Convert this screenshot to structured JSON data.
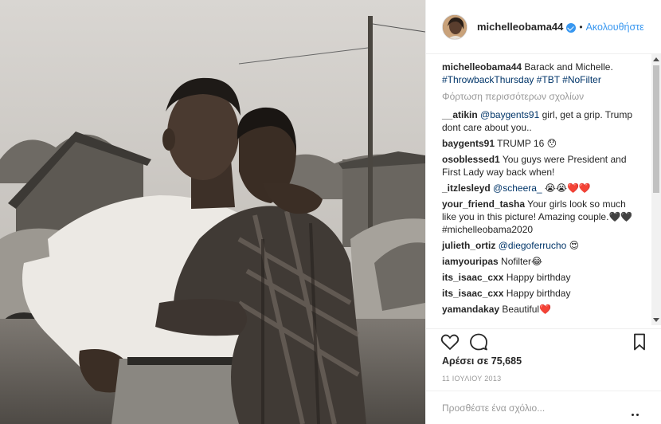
{
  "post": {
    "username": "michelleobama44",
    "separator": "•",
    "follow_label": "Ακολουθήστε",
    "caption_text": "Barack and Michelle.",
    "caption_tags": "#ThrowbackThursday #TBT #NoFilter",
    "load_more": "Φόρτωση περισσότερων σχολίων",
    "likes": "Αρέσει σε 75,685",
    "date": "11 ΙΟΥΛΙΟΥ 2013",
    "comment_placeholder": "Προσθέστε ένα σχόλιο..."
  },
  "comments": [
    {
      "user": "__atikin",
      "mention": "@baygents91",
      "text": " girl, get a grip. Trump dont care about you.."
    },
    {
      "user": "baygents91",
      "mention": "",
      "text": "TRUMP 16 😯"
    },
    {
      "user": "osoblessed1",
      "mention": "",
      "text": "You guys were President and First Lady way back when!"
    },
    {
      "user": "_itzlesleyd",
      "mention": "@scheera_",
      "text": " 😭😭❤️❤️"
    },
    {
      "user": "your_friend_tasha",
      "mention": "",
      "text": "Your girls look so much like you in this picture! Amazing couple.🖤🖤 #michelleobama2020"
    },
    {
      "user": "julieth_ortiz",
      "mention": "@diegoferrucho",
      "text": " 😍"
    },
    {
      "user": "iamyouripas",
      "mention": "",
      "text": "Nofilter😂"
    },
    {
      "user": "its_isaac_cxx",
      "mention": "",
      "text": "Happy birthday"
    },
    {
      "user": "its_isaac_cxx",
      "mention": "",
      "text": "Happy birthday"
    },
    {
      "user": "yamandakay",
      "mention": "",
      "text": "Beautiful❤️"
    }
  ],
  "icons": {
    "like": "heart-icon",
    "comment": "comment-icon",
    "save": "bookmark-icon",
    "options": "more-options-icon"
  }
}
